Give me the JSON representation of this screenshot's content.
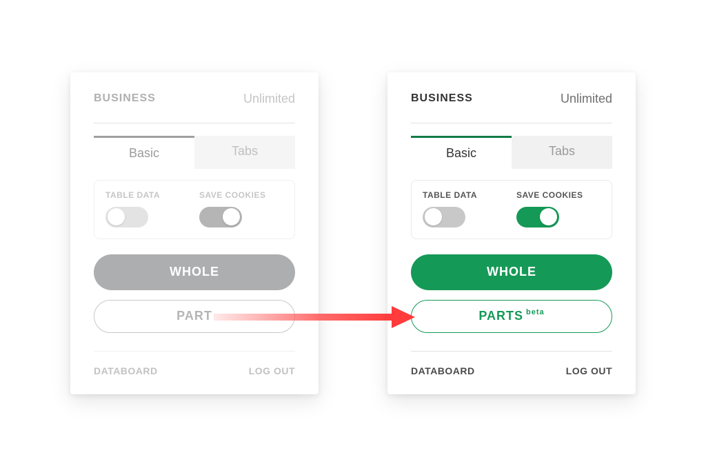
{
  "left": {
    "brand": "BUSINESS",
    "plan": "Unlimited",
    "tabs": {
      "basic": "Basic",
      "other": "Tabs"
    },
    "toggles": {
      "tableData": "TABLE DATA",
      "saveCookies": "SAVE COOKIES"
    },
    "buttons": {
      "whole": "WHOLE",
      "part": "PART"
    },
    "footer": {
      "databoard": "DATABOARD",
      "logout": "LOG OUT"
    }
  },
  "right": {
    "brand": "BUSINESS",
    "plan": "Unlimited",
    "tabs": {
      "basic": "Basic",
      "other": "Tabs"
    },
    "toggles": {
      "tableData": "TABLE DATA",
      "saveCookies": "SAVE COOKIES"
    },
    "buttons": {
      "whole": "WHOLE",
      "parts": "PARTS",
      "beta": "beta"
    },
    "footer": {
      "databoard": "DATABOARD",
      "logout": "LOG OUT"
    }
  }
}
